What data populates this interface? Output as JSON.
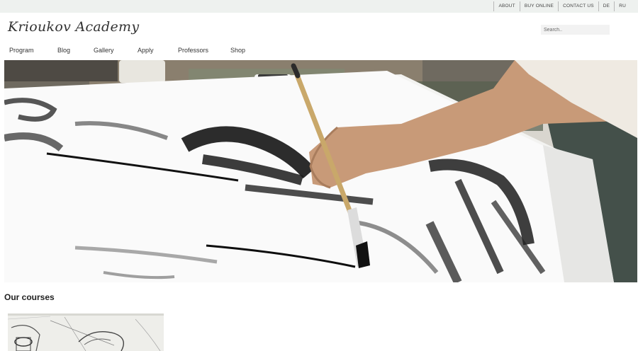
{
  "topbar": {
    "links": [
      "ABOUT",
      "BUY ONLINE",
      "CONTACT US",
      "DE",
      "RU"
    ]
  },
  "header": {
    "logo_text": "Krioukov Academy",
    "search": {
      "placeholder": "Search..",
      "value": ""
    }
  },
  "nav": {
    "items": [
      "Program",
      "Blog",
      "Gallery",
      "Apply",
      "Professors",
      "Shop"
    ]
  },
  "courses": {
    "title": "Our courses"
  }
}
